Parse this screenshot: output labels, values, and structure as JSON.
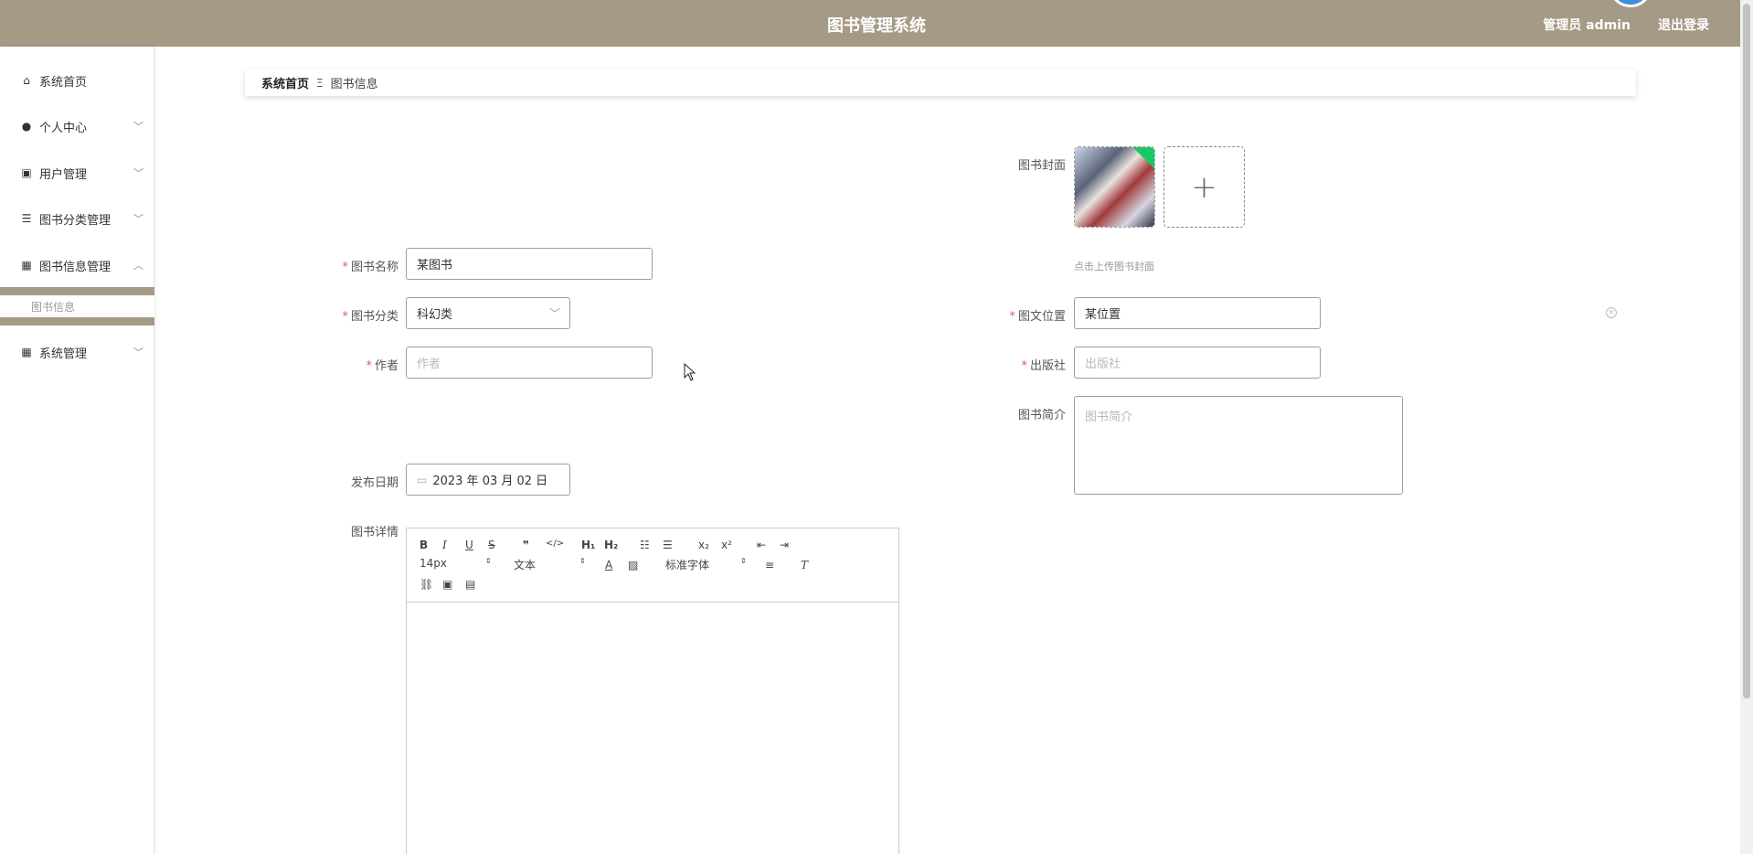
{
  "header": {
    "title": "图书管理系统",
    "user": "管理员 admin",
    "logout": "退出登录"
  },
  "sidebar": {
    "items": [
      {
        "label": "系统首页",
        "icon": "home-icon",
        "has_arrow": false
      },
      {
        "label": "个人中心",
        "icon": "user-icon",
        "has_arrow": true
      },
      {
        "label": "用户管理",
        "icon": "clipboard-icon",
        "has_arrow": true
      },
      {
        "label": "图书分类管理",
        "icon": "list-icon",
        "has_arrow": true
      },
      {
        "label": "图书信息管理",
        "icon": "grid-icon",
        "has_arrow": true,
        "expanded": true
      },
      {
        "label": "系统管理",
        "icon": "grid-icon",
        "has_arrow": true
      }
    ],
    "submenu": {
      "label": "图书信息"
    }
  },
  "breadcrumb": {
    "home": "系统首页",
    "separator": "Ξ",
    "current": "图书信息"
  },
  "form": {
    "cover_label": "图书封面",
    "cover_tip": "点击上传图书封面",
    "name_label": "图书名称",
    "name_value": "某图书",
    "category_label": "图书分类",
    "category_value": "科幻类",
    "location_label": "图文位置",
    "location_value": "某位置",
    "author_label": "作者",
    "author_placeholder": "作者",
    "publisher_label": "出版社",
    "publisher_placeholder": "出版社",
    "intro_label": "图书简介",
    "intro_placeholder": "图书简介",
    "date_label": "发布日期",
    "date_value": "2023 年 03 月 02 日",
    "detail_label": "图书详情"
  },
  "editor": {
    "font_size": "14px",
    "header_select": "文本",
    "font_family": "标准字体"
  },
  "colors": {
    "brand": "#a59a85",
    "required": "#e05a5a",
    "upload_ok": "#17c964"
  }
}
